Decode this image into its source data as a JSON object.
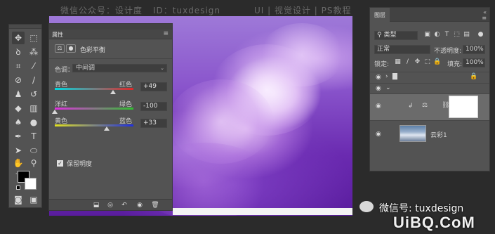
{
  "top_watermark": {
    "wechat": "微信公众号：设计度",
    "id_text": "ID：tuxdesign",
    "ui_text": "UI | 视觉设计 | PS教程"
  },
  "toolbar": {
    "icons": [
      "move-icon",
      "marquee-icon",
      "lasso-icon",
      "magic-wand-icon",
      "crop-icon",
      "eyedropper-icon",
      "healing-brush-icon",
      "brush-icon",
      "clone-stamp-icon",
      "history-brush-icon",
      "eraser-icon",
      "gradient-icon",
      "blur-icon",
      "dodge-icon",
      "pen-icon",
      "type-icon",
      "path-select-icon",
      "shape-icon",
      "hand-icon",
      "zoom-icon",
      "more-icon"
    ],
    "foreground_color": "#000000",
    "background_color": "#ffffff"
  },
  "properties": {
    "tab_title": "属性",
    "adjustment_title": "色彩平衡",
    "tone_label": "色调：",
    "tone_value": "中间调",
    "sliders": [
      {
        "left": "青色",
        "right": "红色",
        "value": "+49",
        "fraction": 0.745,
        "gradient": [
          "#00d8e0",
          "#e02828"
        ]
      },
      {
        "left": "洋红",
        "right": "绿色",
        "value": "-100",
        "fraction": 0.0,
        "gradient": [
          "#e030e0",
          "#30c030"
        ]
      },
      {
        "left": "黄色",
        "right": "蓝色",
        "value": "+33",
        "fraction": 0.665,
        "gradient": [
          "#e0e020",
          "#2030e0"
        ]
      }
    ],
    "preserve_label": "保留明度",
    "preserve_checked": true
  },
  "layers": {
    "tab_title": "图层",
    "filter_label": "类型",
    "blend_mode": "正常",
    "opacity_label": "不透明度:",
    "opacity_value": "100%",
    "lock_label": "锁定:",
    "fill_label": "填充:",
    "fill_value": "100%",
    "items": [
      {
        "name": ""
      },
      {
        "name": ""
      },
      {
        "name": ""
      },
      {
        "name": "云彩1"
      }
    ]
  },
  "bottom_watermark": {
    "wechat": "微信号: tuxdesign",
    "site": "UiBQ.CoM"
  }
}
